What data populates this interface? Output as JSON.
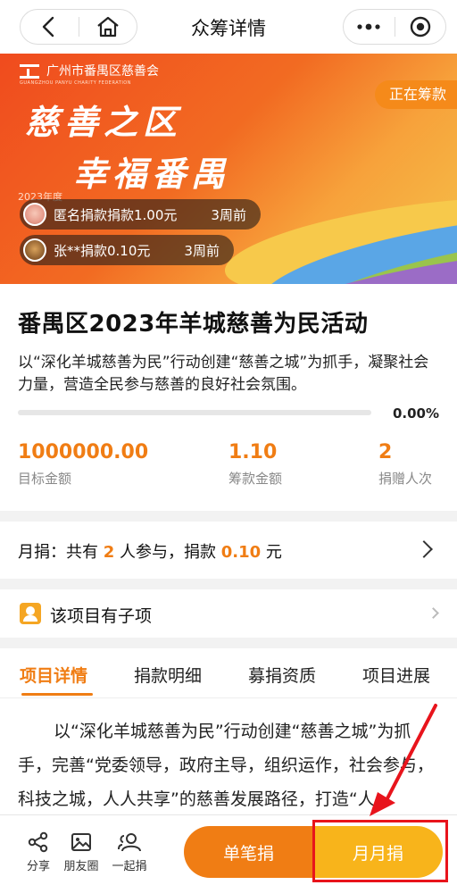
{
  "nav": {
    "title": "众筹详情",
    "back_icon": "chevron-left-icon",
    "home_icon": "home-icon",
    "more_icon": "more-dots-icon",
    "close_icon": "record-circle-icon"
  },
  "banner": {
    "org_name": "广州市番禺区慈善会",
    "org_name_en": "GUANGZHOU PANYU CHARITY FEDERATION",
    "slogan_line1": "慈善之区",
    "slogan_line2": "幸福番禺",
    "year_tag": "2023年度",
    "status": "正在筹款",
    "feed": [
      {
        "text": "匿名捐款捐款1.00元",
        "time": "3周前"
      },
      {
        "text": "张**捐款0.10元",
        "time": "3周前"
      }
    ]
  },
  "project": {
    "title": "番禺区2023年羊城慈善为民活动",
    "description": "以“深化羊城慈善为民”行动创建“慈善之城”为抓手，凝聚社会力量，营造全民参与慈善的良好社会氛围。",
    "progress": 0.0,
    "progress_label": "0.00%",
    "stats": [
      {
        "value": "1000000.00",
        "label": "目标金额"
      },
      {
        "value": "1.10",
        "label": "筹款金额"
      },
      {
        "value": "2",
        "label": "捐赠人次"
      }
    ]
  },
  "monthly": {
    "prefix": "月捐：共有",
    "count": "2",
    "middle": "人参与，捐款",
    "amount": "0.10",
    "suffix": "元"
  },
  "subproject": {
    "label": "该项目有子项"
  },
  "tabs": [
    "项目详情",
    "捐款明细",
    "募捐资质",
    "项目进展"
  ],
  "article": {
    "text": "以“深化羊城慈善为民”行动创建“慈善之城”为抓手，完善“党委领导，政府主导，组织运作，社会参与，科技之城，人人共享”的慈善发展路径，打造“人"
  },
  "bottom": {
    "share": [
      {
        "label": "分享",
        "icon": "share-icon"
      },
      {
        "label": "朋友圈",
        "icon": "moments-icon"
      },
      {
        "label": "一起捐",
        "icon": "group-icon"
      }
    ],
    "single_label": "单笔捐",
    "monthly_label": "月月捐"
  },
  "colors": {
    "accent": "#f07d14",
    "monthly_button": "#f8b41b",
    "annotation": "#e8141c"
  }
}
